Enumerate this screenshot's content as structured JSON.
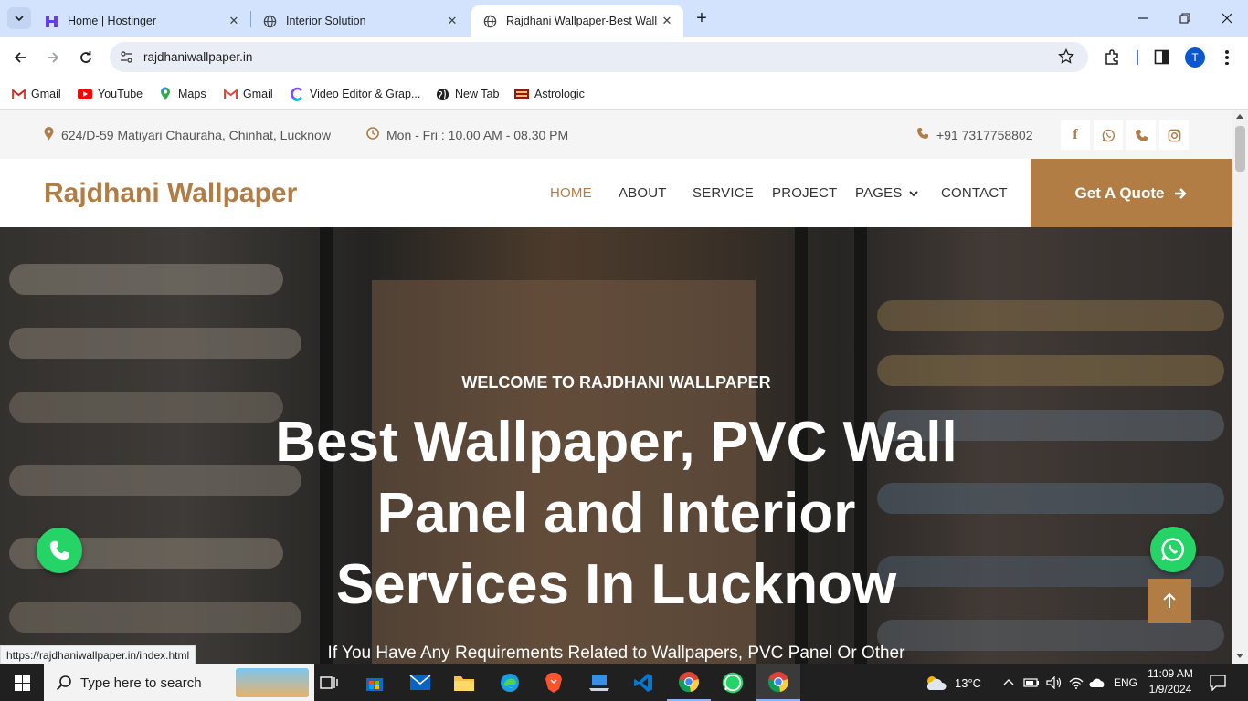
{
  "browser": {
    "tabs": [
      {
        "title": "Home | Hostinger",
        "icon": "hostinger-icon"
      },
      {
        "title": "Interior Solution",
        "icon": "globe-icon"
      },
      {
        "title": "Rajdhani Wallpaper-Best Wallpa",
        "icon": "globe-icon",
        "active": true
      }
    ],
    "url": "rajdhaniwallpaper.in",
    "profile_initial": "T",
    "bookmarks": [
      {
        "label": "Gmail",
        "icon": "gmail-icon"
      },
      {
        "label": "YouTube",
        "icon": "youtube-icon"
      },
      {
        "label": "Maps",
        "icon": "maps-icon"
      },
      {
        "label": "Gmail",
        "icon": "gmail-icon"
      },
      {
        "label": "Video Editor & Grap...",
        "icon": "video-editor-icon"
      },
      {
        "label": "New Tab",
        "icon": "globe-icon"
      },
      {
        "label": "Astrologic",
        "icon": "astrologic-icon"
      }
    ],
    "status_url": "https://rajdhaniwallpaper.in/index.html"
  },
  "site": {
    "topbar": {
      "address": "624/D-59 Matiyari Chauraha, Chinhat, Lucknow",
      "hours": "Mon - Fri : 10.00 AM - 08.30 PM",
      "phone": "+91 7317758802",
      "socials": [
        "facebook-icon",
        "whatsapp-icon",
        "phone-icon",
        "instagram-icon"
      ]
    },
    "brand": "Rajdhani Wallpaper",
    "nav": {
      "home": "HOME",
      "about": "ABOUT",
      "service": "SERVICE",
      "project": "PROJECT",
      "pages": "PAGES",
      "contact": "CONTACT"
    },
    "quote_button": "Get A Quote",
    "hero": {
      "welcome": "WELCOME TO RAJDHANI WALLPAPER",
      "headline_line1": "Best Wallpaper, PVC Wall",
      "headline_line2": "Panel and Interior",
      "headline_line3": "Services In Lucknow",
      "subline": "If You Have Any Requirements Related to Wallpapers, PVC Panel Or Other"
    },
    "accent_color": "#b27c45"
  },
  "taskbar": {
    "search_placeholder": "Type here to search",
    "weather": "13°C",
    "language": "ENG",
    "time": "11:09 AM",
    "date": "1/9/2024"
  }
}
